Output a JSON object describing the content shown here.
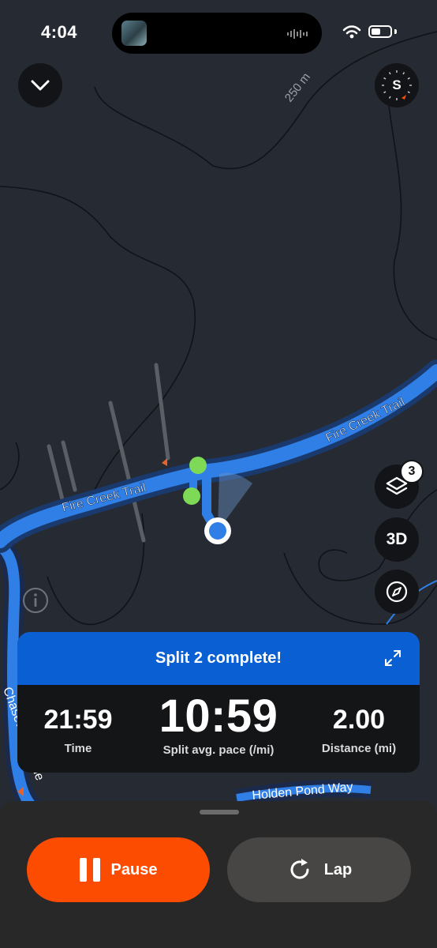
{
  "status_bar": {
    "time": "4:04"
  },
  "map": {
    "contour_label": "250 m",
    "roads": {
      "fire_creek_trail": "Fire Creek Trail",
      "chasewood_lane": "Chasewood Lane",
      "pond_way": "Holden Pond Way"
    },
    "route_color": "#2f7fe6"
  },
  "controls": {
    "compass_letter": "S",
    "layers_badge": "3",
    "toggle_3d": "3D"
  },
  "split_card": {
    "title": "Split 2 complete!",
    "stats": [
      {
        "value": "21:59",
        "label": "Time"
      },
      {
        "value": "10:59",
        "label": "Split avg. pace (/mi)"
      },
      {
        "value": "2.00",
        "label": "Distance (mi)"
      }
    ]
  },
  "actions": {
    "pause_label": "Pause",
    "lap_label": "Lap"
  },
  "colors": {
    "accent": "#fc4c02",
    "split_header": "#0a60d3",
    "map_background": "#262b33"
  }
}
